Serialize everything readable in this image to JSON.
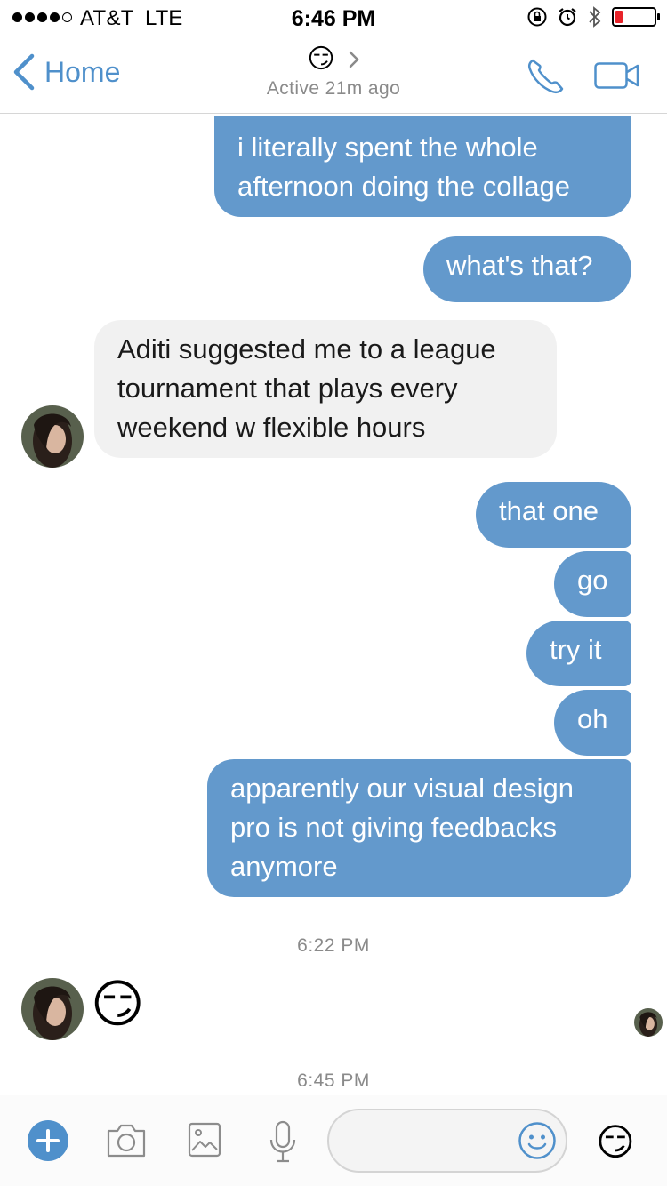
{
  "status_bar": {
    "carrier": "AT&T",
    "network": "LTE",
    "time": "6:46 PM",
    "battery_level": 0.2,
    "battery_color": "#e8232a"
  },
  "nav": {
    "back_label": "Home",
    "title_emoji": "😏",
    "subtitle": "Active 21m ago",
    "accent": "#4f90cb"
  },
  "messages": [
    {
      "direction": "out",
      "text": "i literally spent the whole afternoon doing the collage"
    },
    {
      "direction": "out",
      "text": "what's that?"
    },
    {
      "direction": "in",
      "text": "Aditi suggested me to a league tournament that plays every weekend w flexible hours"
    },
    {
      "direction": "out",
      "text": "that one"
    },
    {
      "direction": "out",
      "text": "go"
    },
    {
      "direction": "out",
      "text": "try it"
    },
    {
      "direction": "out",
      "text": "oh"
    },
    {
      "direction": "out",
      "text": "apparently our visual design pro is not giving feedbacks anymore"
    },
    {
      "direction": "in",
      "text": "😏"
    }
  ],
  "timestamps": [
    "6:22 PM",
    "6:45 PM"
  ],
  "colors": {
    "outgoing_bubble": "#6399cc",
    "incoming_bubble": "#f1f1f1"
  },
  "composer": {
    "icons": [
      "plus-icon",
      "camera-icon",
      "image-icon",
      "microphone-icon",
      "smiley-icon"
    ],
    "input_value": "",
    "quick_emoji": "😏"
  }
}
